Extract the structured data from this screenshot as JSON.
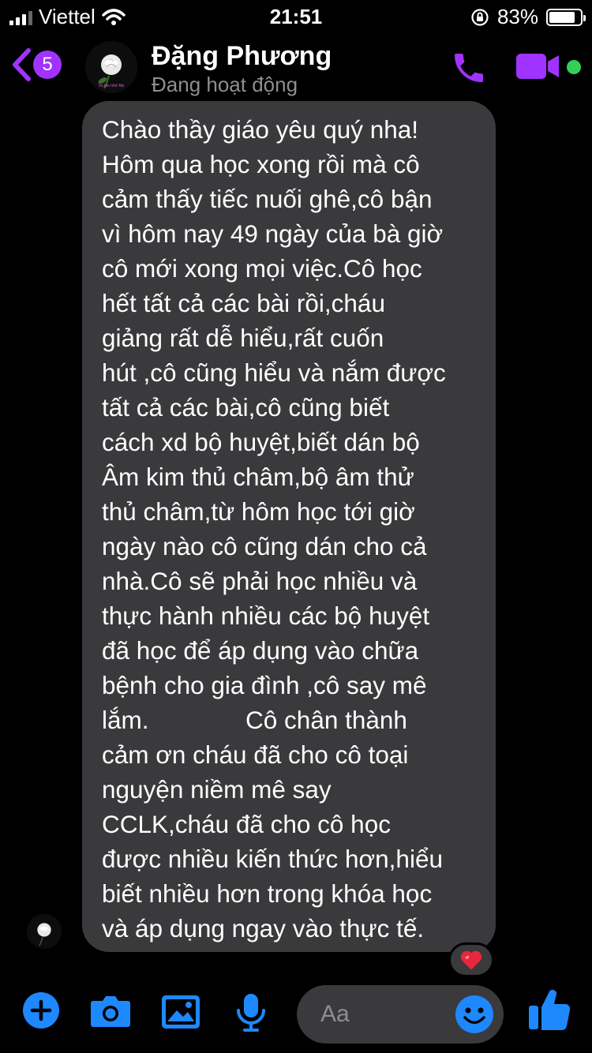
{
  "status_bar": {
    "carrier": "Viettel",
    "time": "21:51",
    "battery_percent": "83%",
    "battery_level": 0.83,
    "icons": [
      "signal-icon",
      "wifi-icon",
      "orientation-lock-icon",
      "battery-icon"
    ]
  },
  "header": {
    "back_badge": "5",
    "contact_name": "Đặng Phương",
    "contact_status": "Đang hoạt động",
    "avatar_caption": "Vu lan nhớ Mẹ",
    "icons": [
      "back-chevron-icon",
      "phone-icon",
      "video-camera-icon"
    ],
    "accent_color": "#a033ff",
    "online_color": "#31d158"
  },
  "message": {
    "lines": [
      "Chào thầy giáo yêu quý nha!",
      "Hôm qua học xong rồi mà cô",
      "cảm thấy tiếc nuối ghê,cô bận",
      "vì hôm nay 49 ngày của bà giờ",
      "cô mới xong mọi việc.Cô học",
      "hết tất cả các bài rồi,cháu",
      "giảng rất dễ hiểu,rất cuốn",
      "hút ,cô cũng hiểu và nắm được",
      "tất cả các bài,cô cũng biết",
      "cách xd bộ huyệt,biết dán bộ",
      "Âm kim thủ châm,bộ âm thử",
      "thủ châm,từ hôm học tới giờ",
      "ngày nào cô cũng dán cho cả",
      "nhà.Cô sẽ phải học nhiều và",
      "thực hành nhiều các bộ huyệt",
      "đã học để áp dụng vào chữa",
      "bệnh cho gia đình ,cô say mê",
      "lắm.              Cô chân thành",
      "cảm ơn cháu đã cho cô toại",
      "nguyện niềm mê say",
      "CCLK,cháu đã cho cô học",
      "được nhiều kiến thức hơn,hiểu",
      "biết nhiều hơn trong khóa học",
      "và áp dụng ngay vào thực tế."
    ],
    "reaction": "heart-icon",
    "bubble_color": "#3a3a3c"
  },
  "composer": {
    "placeholder": "Aa",
    "icons": [
      "plus-icon",
      "camera-icon",
      "image-icon",
      "microphone-icon",
      "emoji-icon",
      "thumbs-up-icon"
    ],
    "accent_color": "#1e88ff"
  }
}
